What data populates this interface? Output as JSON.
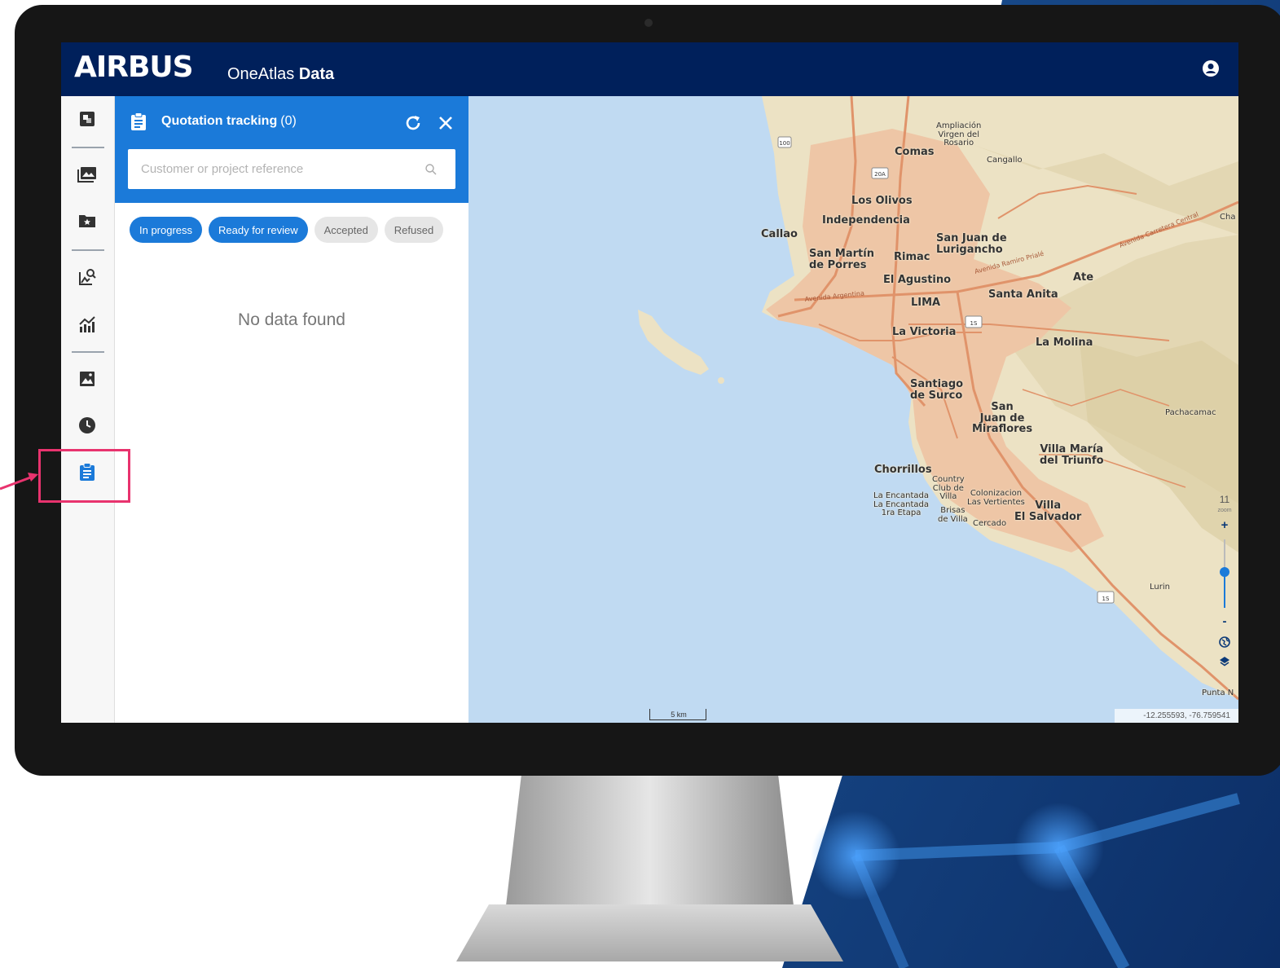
{
  "app": {
    "brand": "AIRBUS",
    "product_prefix": "OneAtlas",
    "product_suffix": "Data"
  },
  "sidebar": {
    "items": [
      {
        "icon": "map-selection-icon"
      },
      {
        "icon": "imagery-gallery-icon"
      },
      {
        "icon": "favorites-folder-icon"
      },
      {
        "icon": "image-search-icon"
      },
      {
        "icon": "analytics-icon"
      },
      {
        "icon": "image-icon"
      },
      {
        "icon": "history-clock-icon"
      },
      {
        "icon": "clipboard-icon",
        "active": true
      }
    ]
  },
  "panel": {
    "title": "Quotation tracking",
    "count": "(0)",
    "search_placeholder": "Customer or project reference",
    "filters": [
      {
        "label": "In progress",
        "active": true
      },
      {
        "label": "Ready for review",
        "active": true
      },
      {
        "label": "Accepted",
        "active": false
      },
      {
        "label": "Refused",
        "active": false
      }
    ],
    "empty_message": "No data found"
  },
  "map": {
    "labels": {
      "ampliacion": "Ampliación\nVirgen del\nRosario",
      "comas": "Comas",
      "cangallo": "Cangallo",
      "cha": "Cha",
      "los_olivos": "Los Olivos",
      "independencia": "Independencia",
      "callao": "Callao",
      "san_juan_lurigancho": "San Juan de\nLurigancho",
      "san_martin": "San Martín\nde Porres",
      "rimac": "Rimac",
      "el_agustino": "El Agustino",
      "ate": "Ate",
      "santa_anita": "Santa Anita",
      "lima": "LIMA",
      "la_victoria": "La Victoria",
      "la_molina": "La Molina",
      "santiago_surco": "Santiago\nde Surco",
      "san_juan_miraflores": "San\nJuan de\nMiraflores",
      "pachacamac": "Pachacamac",
      "villa_maria": "Villa María\ndel Triunfo",
      "chorrillos": "Chorrillos",
      "country_club": "Country\nClub de\nVilla",
      "la_encantada": "La Encantada\nLa Encantada\n1ra Etapa",
      "brisas": "Brisas\nde Villa",
      "colonizacion": "Colonizacion\nLas Vertientes",
      "villa_el_salvador": "Villa\nEl Salvador",
      "cercado": "Cercado",
      "lurin": "Lurin",
      "punta": "Punta N",
      "road_central": "Avenida Carretera Central",
      "road_prialé": "Avenida Ramiro Prialé",
      "road_argentina": "Avenida Argentina",
      "route_100": "100",
      "route_20a": "20A",
      "route_1s": "1S",
      "route_1s_b": "1S"
    },
    "zoom": {
      "level": "11",
      "word": "zoom",
      "plus": "+",
      "minus": "-"
    },
    "scale": "5 km",
    "coordinates": "-12.255593, -76.759541",
    "colors": {
      "water": "#c0daf2",
      "land": "#ece2c4",
      "urban": "#eec6a6",
      "roads": "#e0936a"
    }
  },
  "colors": {
    "topbar": "#00205b",
    "accent": "#1b7ad9",
    "highlight": "#e8336e"
  }
}
